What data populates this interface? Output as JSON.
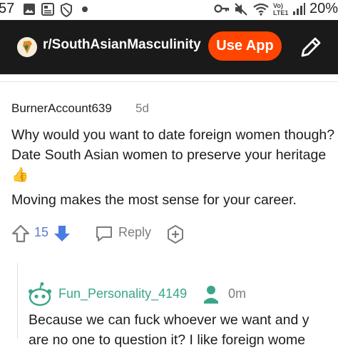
{
  "status_bar": {
    "time": "57",
    "right_text": "20%",
    "network": "Vo) LTE1",
    "icons": [
      "image-icon",
      "news-icon",
      "shield-icon",
      "dot-icon",
      "key-icon",
      "mute-icon",
      "wifi-icon",
      "signal-icon"
    ]
  },
  "header": {
    "subreddit": "r/SouthAsianMasculinity",
    "use_app_label": "Use App",
    "accent": "#ff4500",
    "background": "#1a1a1b"
  },
  "comment1": {
    "author": "BurnerAccount639",
    "age": "5d",
    "paragraph1": "Why would you want to date foreign women though? Date South Asian women to preserve your heritage 👍",
    "paragraph2": "Moving makes the most sense for your career.",
    "score": "15",
    "reply_label": "Reply"
  },
  "comment2": {
    "author": "Fun_Personality_4149",
    "age": "0m",
    "text_line1": "Because we can fuck whoever we want and y",
    "text_line2": "are no one to question it? I like foreign wome",
    "author_color": "#3aa58a"
  }
}
